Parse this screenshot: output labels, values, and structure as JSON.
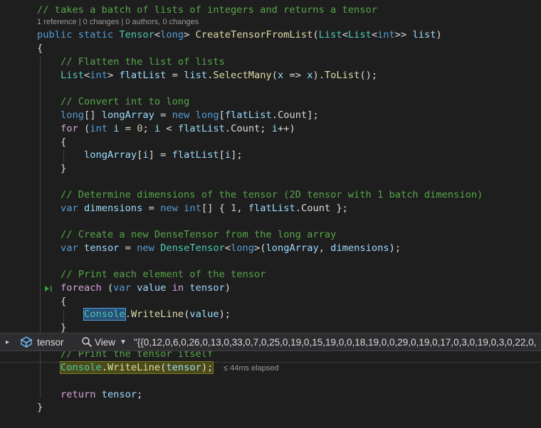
{
  "codelens": "1 reference | 0 changes | 0 authors, 0 changes",
  "code": {
    "l1": "// takes a batch of lists of integers and returns a tensor",
    "l2": {
      "public": "public",
      "static": "static",
      "tensor_t": "Tensor",
      "lt": "<",
      "long": "long",
      "gt": "> ",
      "method": "CreateTensorFromList",
      "p1": "(",
      "list1": "List",
      "lt2": "<",
      "list2": "List",
      "lt3": "<",
      "int": "int",
      "gt2": ">> ",
      "param": "list",
      "p2": ")"
    },
    "l3": "{",
    "l4": "// Flatten the list of lists",
    "l5": {
      "list": "List",
      "lt": "<",
      "int": "int",
      "gt": "> ",
      "var": "flatList",
      "eq": " = ",
      "obj": "list",
      "dot": ".",
      "m": "SelectMany",
      "a": "(",
      "x": "x",
      "arrow": " => ",
      "x2": "x",
      "b": ").",
      "m2": "ToList",
      "c": "();"
    },
    "l6": "// Convert int to long",
    "l7": {
      "long": "long",
      "arr": "[] ",
      "var": "longArray",
      "eq": " = ",
      "new": "new",
      "sp": " ",
      "long2": "long",
      "br": "[",
      "fl": "flatList",
      "dot": ".",
      "count": "Count",
      "end": "];"
    },
    "l8": {
      "for": "for",
      "a": " (",
      "int": "int",
      "sp": " ",
      "i": "i",
      "eq": " = ",
      "zero": "0",
      "s1": "; ",
      "i2": "i",
      "lt": " < ",
      "fl": "flatList",
      "dot": ".",
      "count": "Count",
      "s2": "; ",
      "i3": "i",
      "inc": "++)"
    },
    "l9": "{",
    "l10": {
      "arr": "longArray",
      "a": "[",
      "i": "i",
      "b": "] = ",
      "fl": "flatList",
      "c": "[",
      "i2": "i",
      "d": "];"
    },
    "l11": "}",
    "l12": "// Determine dimensions of the tensor (2D tensor with 1 batch dimension)",
    "l13": {
      "var": "var",
      "sp": " ",
      "name": "dimensions",
      "eq": " = ",
      "new": "new",
      "sp2": " ",
      "int": "int",
      "a": "[] { ",
      "one": "1",
      "b": ", ",
      "fl": "flatList",
      "dot": ".",
      "count": "Count",
      "c": " };"
    },
    "l14": "// Create a new DenseTensor from the long array",
    "l15": {
      "var": "var",
      "sp": " ",
      "name": "tensor",
      "eq": " = ",
      "new": "new",
      "sp2": " ",
      "dt": "DenseTensor",
      "lt": "<",
      "long": "long",
      "gt": ">(",
      "arr": "longArray",
      "cm": ", ",
      "dims": "dimensions",
      "end": ");"
    },
    "l16": "// Print each element of the tensor",
    "l17": {
      "foreach": "foreach",
      "a": " (",
      "var": "var",
      "sp": " ",
      "value": "value",
      "sp2": " ",
      "in": "in",
      "sp3": " ",
      "tensor": "tensor",
      "b": ")"
    },
    "l18": "{",
    "l19": {
      "console": "Console",
      "dot": ".",
      "m": "WriteLine",
      "a": "(",
      "value": "value",
      "b": ");"
    },
    "l20": "}",
    "l21": "// Print the tensor itself",
    "l22": {
      "console": "Console",
      "dot": ".",
      "m": "WriteLine",
      "a": "(",
      "tensor": "tensor",
      "b": ");"
    },
    "l23": {
      "ret": "return",
      "sp": " ",
      "tensor": "tensor",
      "semi": ";"
    },
    "l24": "}"
  },
  "elapsed": "≤ 44ms elapsed",
  "datatip": {
    "name": "tensor",
    "view_label": "View",
    "value": "\"{{0,12,0,6,0,26,0,13,0,33,0,7,0,25,0,19,0,15,19,0,0,18,19,0,0,29,0,19,0,17,0,3,0,19,0,3,0,22,0,"
  },
  "icons": {
    "expand": "chevron-right-icon",
    "object": "object-cube-icon",
    "search": "magnifier-icon",
    "caret": "caret-down-icon",
    "current_stmt": "step-arrow-icon"
  },
  "colors": {
    "keyword": "#569cd6",
    "type": "#4ec9b0",
    "comment": "#57a64a",
    "method": "#dcdcaa",
    "variable": "#9cdcfe",
    "number": "#b5cea8",
    "control": "#d8a0df"
  }
}
